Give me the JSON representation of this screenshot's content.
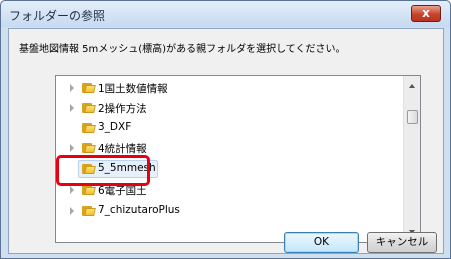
{
  "window": {
    "title": "フォルダーの参照",
    "close_label": "x"
  },
  "dialog": {
    "instruction": "基盤地図情報 5mメッシュ(標高)がある親フォルダを選択してください。"
  },
  "tree": {
    "items": [
      {
        "label": "1国土数値情報",
        "expandable": true
      },
      {
        "label": "2操作方法",
        "expandable": true
      },
      {
        "label": "3_DXF",
        "expandable": false
      },
      {
        "label": "4統計情報",
        "expandable": true
      },
      {
        "label": "5_5mmesh",
        "expandable": false,
        "selected": true
      },
      {
        "label": "6電子国土",
        "expandable": true
      },
      {
        "label": "7_chizutaroPlus",
        "expandable": true
      }
    ]
  },
  "buttons": {
    "ok_label": "OK",
    "cancel_label": "キャンセル"
  },
  "colors": {
    "highlight": "#e60012",
    "folder": "#f2bf2e",
    "selection": "#e6f0fa"
  }
}
